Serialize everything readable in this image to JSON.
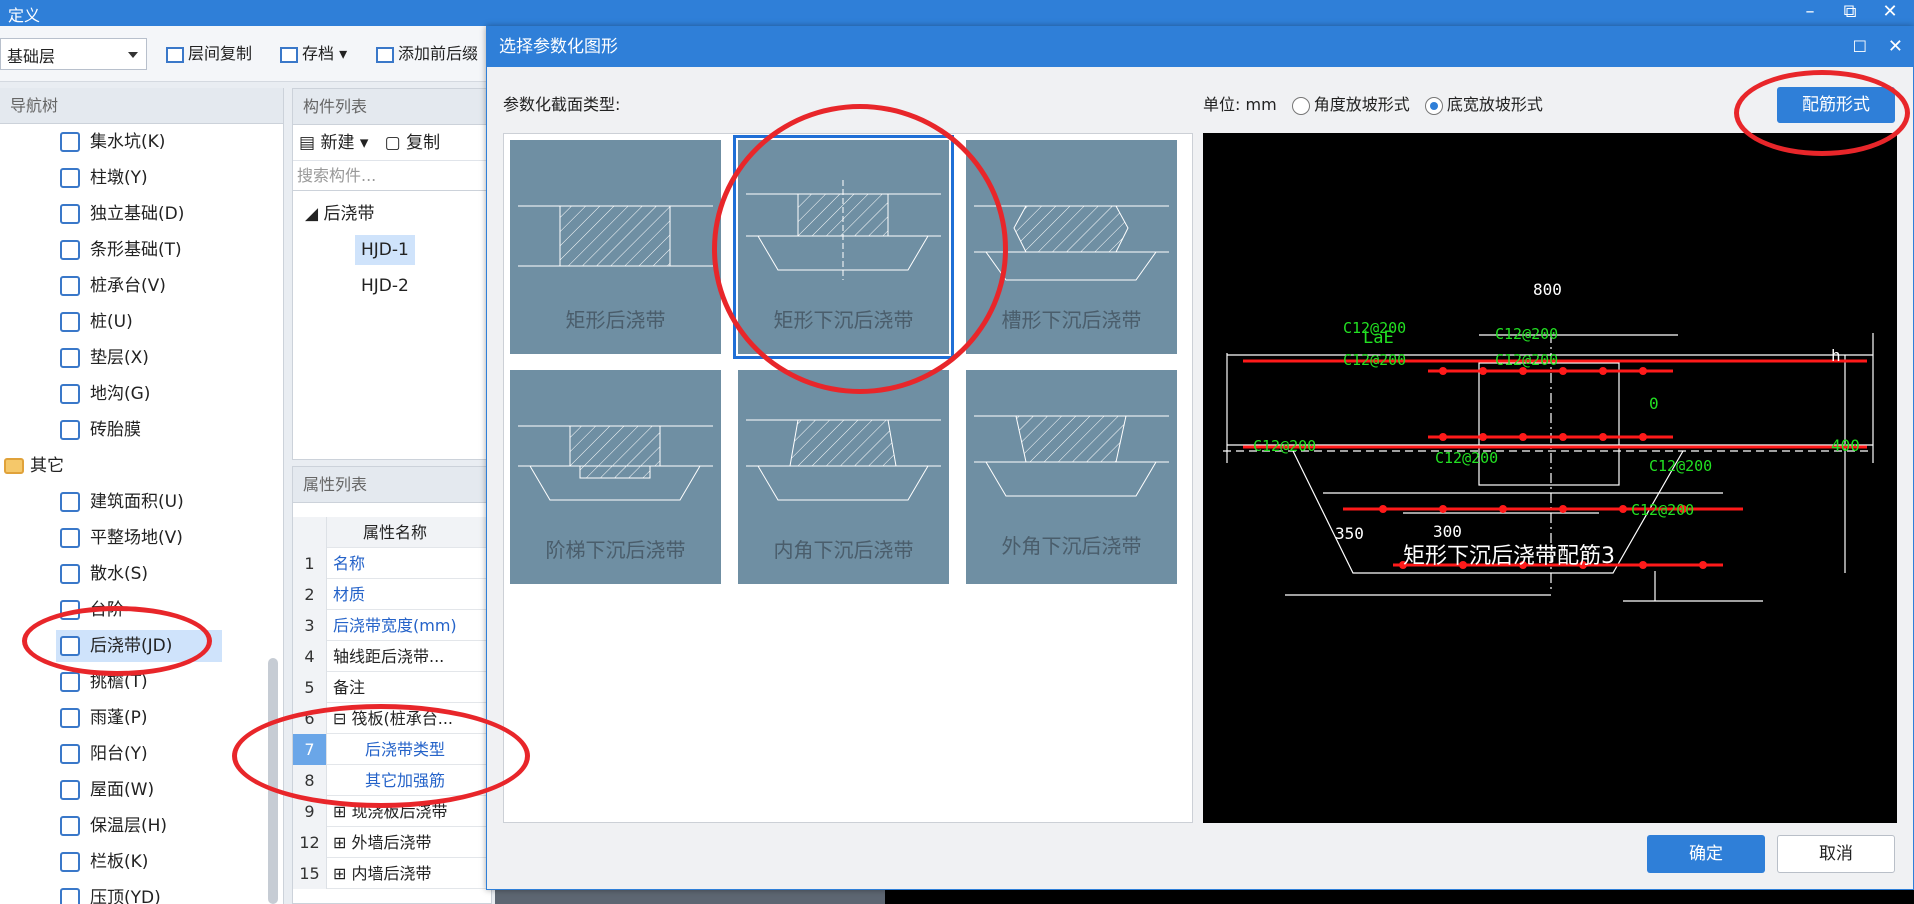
{
  "window": {
    "title": "定义",
    "minimize": "–",
    "restore": "⧉",
    "close": "✕"
  },
  "toolbar": {
    "floor": "基础层",
    "copy_between_floors": "层间复制",
    "save": "存档",
    "add_prefix_suffix": "添加前后缀"
  },
  "nav": {
    "title": "导航树",
    "items": [
      {
        "label": "集水坑(K)"
      },
      {
        "label": "柱墩(Y)"
      },
      {
        "label": "独立基础(D)"
      },
      {
        "label": "条形基础(T)"
      },
      {
        "label": "桩承台(V)"
      },
      {
        "label": "桩(U)"
      },
      {
        "label": "垫层(X)"
      },
      {
        "label": "地沟(G)"
      },
      {
        "label": "砖胎膜"
      }
    ],
    "group": "其它",
    "group_items": [
      {
        "label": "建筑面积(U)"
      },
      {
        "label": "平整场地(V)"
      },
      {
        "label": "散水(S)"
      },
      {
        "label": "台阶"
      },
      {
        "label": "后浇带(JD)"
      },
      {
        "label": "挑檐(T)"
      },
      {
        "label": "雨蓬(P)"
      },
      {
        "label": "阳台(Y)"
      },
      {
        "label": "屋面(W)"
      },
      {
        "label": "保温层(H)"
      },
      {
        "label": "栏板(K)"
      },
      {
        "label": "压顶(YD)"
      }
    ]
  },
  "component_list": {
    "title": "构件列表",
    "new": "新建",
    "copy": "复制",
    "search_placeholder": "搜索构件...",
    "group": "后浇带",
    "items": [
      "HJD-1",
      "HJD-2"
    ]
  },
  "properties": {
    "title": "属性列表",
    "header_name": "属性名称",
    "rows": [
      {
        "num": "1",
        "name": "名称"
      },
      {
        "num": "2",
        "name": "材质"
      },
      {
        "num": "3",
        "name": "后浇带宽度(mm)"
      },
      {
        "num": "4",
        "name": "轴线距后浇带..."
      },
      {
        "num": "5",
        "name": "备注"
      },
      {
        "num": "6",
        "name": "筏板(桩承台..."
      },
      {
        "num": "7",
        "name": "后浇带类型"
      },
      {
        "num": "8",
        "name": "其它加强筋"
      },
      {
        "num": "9",
        "name": "现浇板后浇带"
      },
      {
        "num": "12",
        "name": "外墙后浇带"
      },
      {
        "num": "15",
        "name": "内墙后浇带"
      }
    ]
  },
  "dialog": {
    "title": "选择参数化图形",
    "type_label": "参数化截面类型:",
    "unit_label": "单位: mm",
    "radio_angle": "角度放坡形式",
    "radio_width": "底宽放坡形式",
    "rebar_button": "配筋形式",
    "ok": "确定",
    "cancel": "取消",
    "shapes": [
      {
        "label": "矩形后浇带"
      },
      {
        "label": "矩形下沉后浇带"
      },
      {
        "label": "槽形下沉后浇带"
      },
      {
        "label": "阶梯下沉后浇带"
      },
      {
        "label": "内角下沉后浇带"
      },
      {
        "label": "外角下沉后浇带"
      }
    ],
    "preview": {
      "caption": "矩形下沉后浇带配筋3",
      "dim_800": "800",
      "dim_lae": "LaE",
      "dim_h": "h",
      "dim_0": "0",
      "dim_400": "400",
      "dim_350": "350",
      "dim_300": "300",
      "rebar_labels": [
        "C12@200",
        "C12@200",
        "C12@200",
        "C12@200",
        "C12@200",
        "C12@200",
        "C12@200",
        "C12@200"
      ],
      "colors": {
        "rebar": "#ff1a1a",
        "label": "#22e022",
        "line": "#ffffff"
      }
    }
  }
}
